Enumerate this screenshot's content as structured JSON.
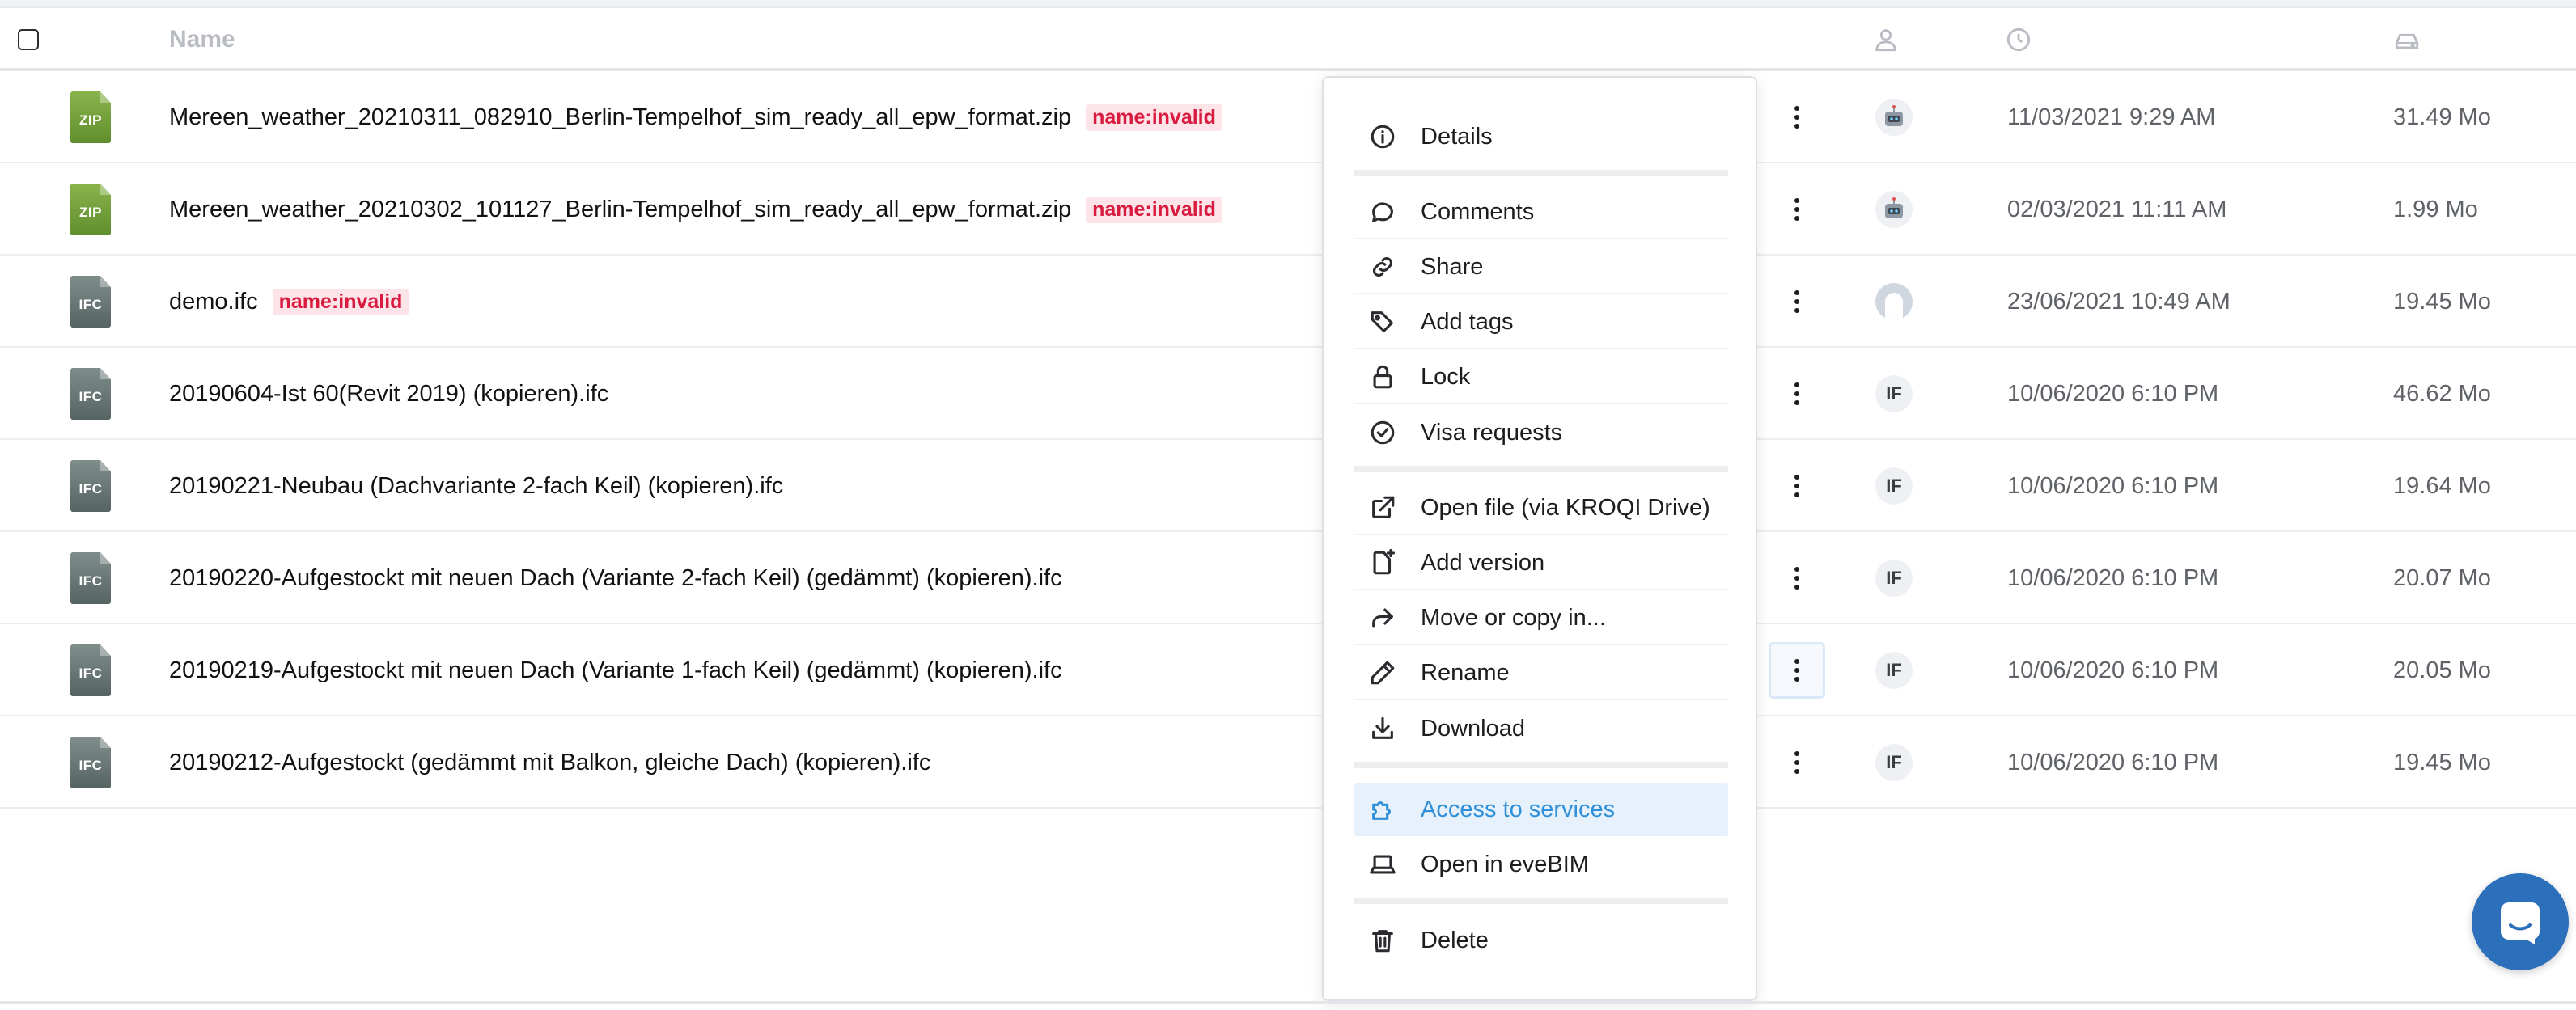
{
  "header": {
    "name_label": "Name",
    "owner_icon": "person-icon",
    "date_icon": "clock-icon",
    "size_icon": "drive-icon"
  },
  "files": [
    {
      "type": "ZIP",
      "name": "Mereen_weather_20210311_082910_Berlin-Tempelhof_sim_ready_all_epw_format.zip",
      "tag": "name:invalid",
      "owner": "robot",
      "owner_label": "",
      "date": "11/03/2021 9:29 AM",
      "size": "31.49 Mo"
    },
    {
      "type": "ZIP",
      "name": "Mereen_weather_20210302_101127_Berlin-Tempelhof_sim_ready_all_epw_format.zip",
      "tag": "name:invalid",
      "owner": "robot",
      "owner_label": "",
      "date": "02/03/2021 11:11 AM",
      "size": "1.99 Mo"
    },
    {
      "type": "IFC",
      "name": "demo.ifc",
      "tag": "name:invalid",
      "owner": "person",
      "owner_label": "",
      "date": "23/06/2021 10:49 AM",
      "size": "19.45 Mo"
    },
    {
      "type": "IFC",
      "name": "20190604-Ist 60(Revit 2019) (kopieren).ifc",
      "tag": "",
      "owner": "initials",
      "owner_label": "IF",
      "date": "10/06/2020 6:10 PM",
      "size": "46.62 Mo"
    },
    {
      "type": "IFC",
      "name": "20190221-Neubau (Dachvariante 2-fach Keil) (kopieren).ifc",
      "tag": "",
      "owner": "initials",
      "owner_label": "IF",
      "date": "10/06/2020 6:10 PM",
      "size": "19.64 Mo"
    },
    {
      "type": "IFC",
      "name": "20190220-Aufgestockt mit neuen Dach (Variante 2-fach Keil) (gedämmt) (kopieren).ifc",
      "tag": "",
      "owner": "initials",
      "owner_label": "IF",
      "date": "10/06/2020 6:10 PM",
      "size": "20.07 Mo"
    },
    {
      "type": "IFC",
      "name": "20190219-Aufgestockt mit neuen Dach (Variante 1-fach Keil) (gedämmt) (kopieren).ifc",
      "tag": "",
      "owner": "initials",
      "owner_label": "IF",
      "date": "10/06/2020 6:10 PM",
      "size": "20.05 Mo"
    },
    {
      "type": "IFC",
      "name": "20190212-Aufgestockt (gedämmt mit Balkon, gleiche Dach) (kopieren).ifc",
      "tag": "",
      "owner": "initials",
      "owner_label": "IF",
      "date": "10/06/2020 6:10 PM",
      "size": "19.45 Mo"
    }
  ],
  "context_menu": {
    "details": "Details",
    "comments": "Comments",
    "share": "Share",
    "add_tags": "Add tags",
    "lock": "Lock",
    "visa_requests": "Visa requests",
    "open_file": "Open file (via KROQI Drive)",
    "add_version": "Add version",
    "move_copy": "Move or copy in...",
    "rename": "Rename",
    "download": "Download",
    "access_services": "Access to services",
    "open_evebim": "Open in eveBIM",
    "delete": "Delete"
  },
  "colors": {
    "accent": "#2f8fd8",
    "tag_text": "#d81b3f",
    "tag_bg": "#fde4e9",
    "chat_fab": "#2c6fbb"
  }
}
